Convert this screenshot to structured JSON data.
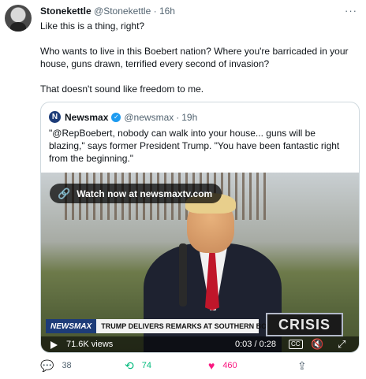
{
  "tweet": {
    "author_name": "Stonekettle",
    "author_handle": "@Stonekettle",
    "separator": "·",
    "time": "16h",
    "text_lines": [
      "Like this is a thing, right?",
      "Who wants to live in this Boebert nation? Where you're barricaded in your",
      "house, guns drawn, terrified every second of invasion?",
      "That doesn't sound like freedom to me."
    ],
    "more_icon": "···"
  },
  "quote": {
    "logo_letter": "N",
    "name": "Newsmax",
    "verified_icon": "✓",
    "handle": "@newsmax",
    "separator": "·",
    "time": "19h",
    "text": "\"@RepBoebert, nobody can walk into your house... guns will be blazing,\" says former President Trump. \"You have been fantastic right from the beginning.\""
  },
  "video": {
    "watch_label": "Watch now at newsmaxtv.com",
    "link_icon": "🔗",
    "chyron_logo": "NEWSMAX",
    "chyron_headline": "TRUMP DELIVERS REMARKS AT SOUTHERN BORDER",
    "crisis_label": "CRISIS",
    "views": "71.6K views",
    "duration": "0:03 / 0:28",
    "cc_label": "CC",
    "mute_icon": "🔇",
    "fullscreen_icon": "⤢"
  },
  "actions": {
    "reply_icon": "💬",
    "reply_count": "38",
    "retweet_icon": "⟲",
    "retweet_count": "74",
    "like_icon": "♥",
    "like_count": "460",
    "share_icon": "⇪"
  },
  "colors": {
    "retweet": "#00ba7c",
    "like": "#f91880",
    "verified": "#1d9bf0",
    "newsmax": "#1d3c78"
  }
}
